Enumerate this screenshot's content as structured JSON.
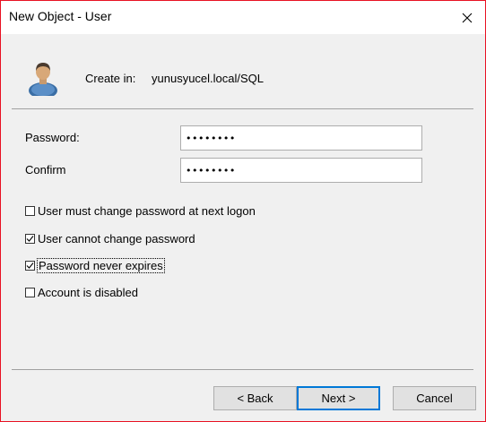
{
  "window": {
    "title": "New Object - User",
    "close_icon": "close-icon"
  },
  "header": {
    "icon": "user-icon",
    "create_in_label": "Create in:",
    "create_in_value": "yunusyucel.local/SQL"
  },
  "form": {
    "password_label": "Password:",
    "password_value": "••••••••",
    "confirm_label": "Confirm",
    "confirm_value": "••••••••"
  },
  "options": [
    {
      "label": "User must change password at next logon",
      "checked": false
    },
    {
      "label": "User cannot change password",
      "checked": true
    },
    {
      "label": "Password never expires",
      "checked": true,
      "focused": true
    },
    {
      "label": "Account is disabled",
      "checked": false
    }
  ],
  "buttons": {
    "back_label": "< Back",
    "next_label": "Next >",
    "cancel_label": "Cancel"
  },
  "colors": {
    "window_border": "#e81123",
    "dialog_background": "#f0f0f0",
    "default_button_border": "#0078d7"
  }
}
